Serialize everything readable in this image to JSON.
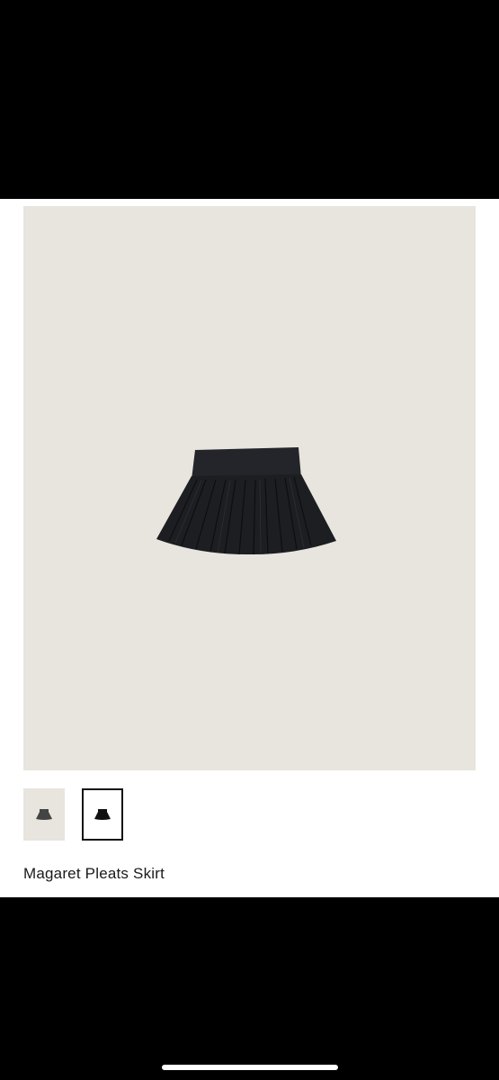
{
  "product": {
    "title": "Magaret Pleats Skirt",
    "main_image_icon": "pleated-skirt-icon",
    "selected_thumbnail": 2
  },
  "thumbnails": [
    {
      "icon": "skirt-gray-icon",
      "color": "#444444"
    },
    {
      "icon": "skirt-black-icon",
      "color": "#111111"
    }
  ],
  "colors": {
    "image_background": "#e8e4de",
    "page_background": "#ffffff",
    "frame_background": "#000000",
    "skirt": "#1c1e22"
  }
}
